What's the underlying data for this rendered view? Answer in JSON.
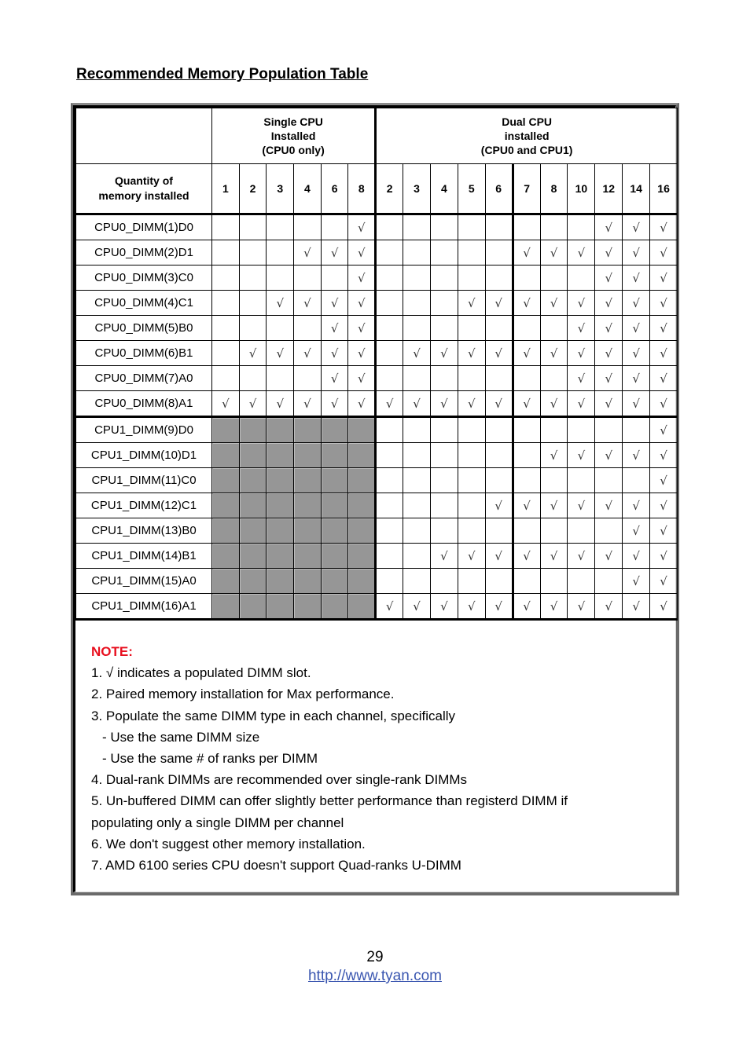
{
  "title": "Recommended Memory Population Table",
  "table": {
    "group_headers": [
      {
        "label_lines": [
          "Single CPU",
          "Installed",
          "(CPU0 only)"
        ]
      },
      {
        "label_lines": [
          "Dual CPU",
          "installed",
          "(CPU0 and CPU1)"
        ]
      }
    ],
    "quantity_header_lines": [
      "Quantity of",
      "memory installed"
    ],
    "single_cpu_quantities": [
      "1",
      "2",
      "3",
      "4",
      "6",
      "8"
    ],
    "dual_cpu_quantities": [
      "2",
      "3",
      "4",
      "5",
      "6",
      "7",
      "8",
      "10",
      "12",
      "14",
      "16"
    ],
    "check_symbol": "√",
    "rows": [
      {
        "label": "CPU0_DIMM(1)D0",
        "single": [
          0,
          0,
          0,
          0,
          0,
          1
        ],
        "dual": [
          0,
          0,
          0,
          0,
          0,
          0,
          0,
          0,
          1,
          1,
          1
        ]
      },
      {
        "label": "CPU0_DIMM(2)D1",
        "single": [
          0,
          0,
          0,
          1,
          1,
          1
        ],
        "dual": [
          0,
          0,
          0,
          0,
          0,
          1,
          1,
          1,
          1,
          1,
          1
        ]
      },
      {
        "label": "CPU0_DIMM(3)C0",
        "single": [
          0,
          0,
          0,
          0,
          0,
          1
        ],
        "dual": [
          0,
          0,
          0,
          0,
          0,
          0,
          0,
          0,
          1,
          1,
          1
        ]
      },
      {
        "label": "CPU0_DIMM(4)C1",
        "single": [
          0,
          0,
          1,
          1,
          1,
          1
        ],
        "dual": [
          0,
          0,
          0,
          1,
          1,
          1,
          1,
          1,
          1,
          1,
          1
        ]
      },
      {
        "label": "CPU0_DIMM(5)B0",
        "single": [
          0,
          0,
          0,
          0,
          1,
          1
        ],
        "dual": [
          0,
          0,
          0,
          0,
          0,
          0,
          0,
          1,
          1,
          1,
          1
        ]
      },
      {
        "label": "CPU0_DIMM(6)B1",
        "single": [
          0,
          1,
          1,
          1,
          1,
          1
        ],
        "dual": [
          0,
          1,
          1,
          1,
          1,
          1,
          1,
          1,
          1,
          1,
          1
        ]
      },
      {
        "label": "CPU0_DIMM(7)A0",
        "single": [
          0,
          0,
          0,
          0,
          1,
          1
        ],
        "dual": [
          0,
          0,
          0,
          0,
          0,
          0,
          0,
          1,
          1,
          1,
          1
        ]
      },
      {
        "label": "CPU0_DIMM(8)A1",
        "single": [
          1,
          1,
          1,
          1,
          1,
          1
        ],
        "dual": [
          1,
          1,
          1,
          1,
          1,
          1,
          1,
          1,
          1,
          1,
          1
        ]
      },
      {
        "label": "CPU1_DIMM(9)D0",
        "single": null,
        "dual": [
          0,
          0,
          0,
          0,
          0,
          0,
          0,
          0,
          0,
          0,
          1
        ]
      },
      {
        "label": "CPU1_DIMM(10)D1",
        "single": null,
        "dual": [
          0,
          0,
          0,
          0,
          0,
          0,
          1,
          1,
          1,
          1,
          1
        ]
      },
      {
        "label": "CPU1_DIMM(11)C0",
        "single": null,
        "dual": [
          0,
          0,
          0,
          0,
          0,
          0,
          0,
          0,
          0,
          0,
          1
        ]
      },
      {
        "label": "CPU1_DIMM(12)C1",
        "single": null,
        "dual": [
          0,
          0,
          0,
          0,
          1,
          1,
          1,
          1,
          1,
          1,
          1
        ]
      },
      {
        "label": "CPU1_DIMM(13)B0",
        "single": null,
        "dual": [
          0,
          0,
          0,
          0,
          0,
          0,
          0,
          0,
          0,
          1,
          1
        ]
      },
      {
        "label": "CPU1_DIMM(14)B1",
        "single": null,
        "dual": [
          0,
          0,
          1,
          1,
          1,
          1,
          1,
          1,
          1,
          1,
          1
        ]
      },
      {
        "label": "CPU1_DIMM(15)A0",
        "single": null,
        "dual": [
          0,
          0,
          0,
          0,
          0,
          0,
          0,
          0,
          0,
          1,
          1
        ]
      },
      {
        "label": "CPU1_DIMM(16)A1",
        "single": null,
        "dual": [
          1,
          1,
          1,
          1,
          1,
          1,
          1,
          1,
          1,
          1,
          1
        ]
      }
    ]
  },
  "notes": {
    "title": "NOTE:",
    "lines": [
      {
        "text": "1. √ indicates a populated DIMM slot.",
        "indent": false
      },
      {
        "text": "2. Paired memory installation for Max performance.",
        "indent": false
      },
      {
        "text": "3. Populate the same DIMM type in each channel, specifically",
        "indent": false
      },
      {
        "text": "- Use the same DIMM size",
        "indent": true
      },
      {
        "text": "- Use the same # of ranks per DIMM",
        "indent": true
      },
      {
        "text": "4. Dual-rank DIMMs are recommended over single-rank DIMMs",
        "indent": false
      },
      {
        "text": "5. Un-buffered DIMM can offer slightly better performance than registerd DIMM if",
        "indent": false
      },
      {
        "text": "populating only a single DIMM per channel",
        "indent": false
      },
      {
        "text": "6. We don't suggest other memory installation.",
        "indent": false
      },
      {
        "text": "7. AMD 6100 series CPU doesn't support Quad-ranks U-DIMM",
        "indent": false
      }
    ]
  },
  "footer": {
    "page_number": "29",
    "link_text": "http://www.tyan.com"
  },
  "colors": {
    "note_title": "#e8101f",
    "link": "#3a56b0",
    "shaded_cell": "#969696"
  }
}
